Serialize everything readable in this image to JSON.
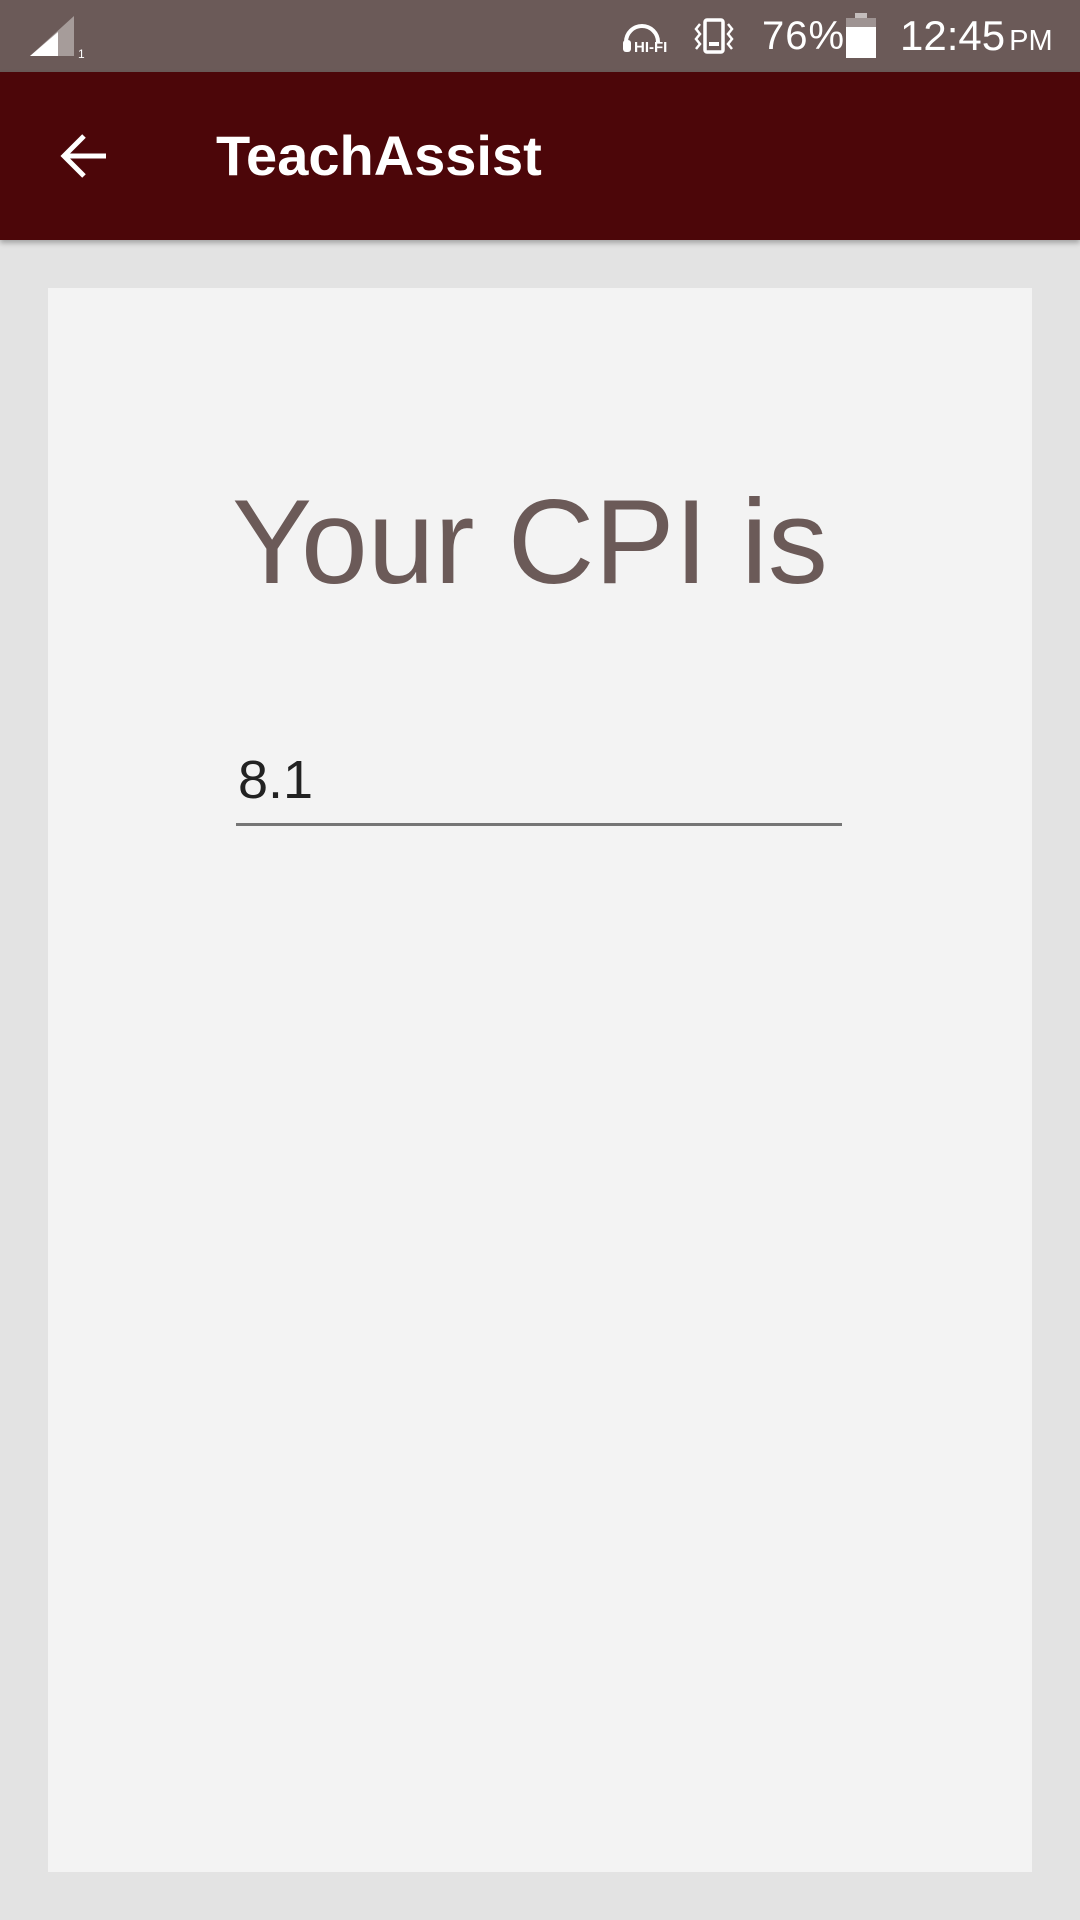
{
  "status_bar": {
    "icons": [
      "cell-signal-icon",
      "hifi-headset-icon",
      "vibrate-icon",
      "battery-icon"
    ],
    "battery_percent": "76%",
    "time": "12:45",
    "time_suffix": "PM",
    "hifi_label": "HI-FI",
    "background_color": "#6b5a58"
  },
  "app_bar": {
    "back_icon": "arrow-back-icon",
    "title": "TeachAssist",
    "background_color": "#4c0609"
  },
  "card": {
    "heading": "Your CPI is",
    "cpi_value": "8.1",
    "heading_color": "#6b5a58"
  }
}
